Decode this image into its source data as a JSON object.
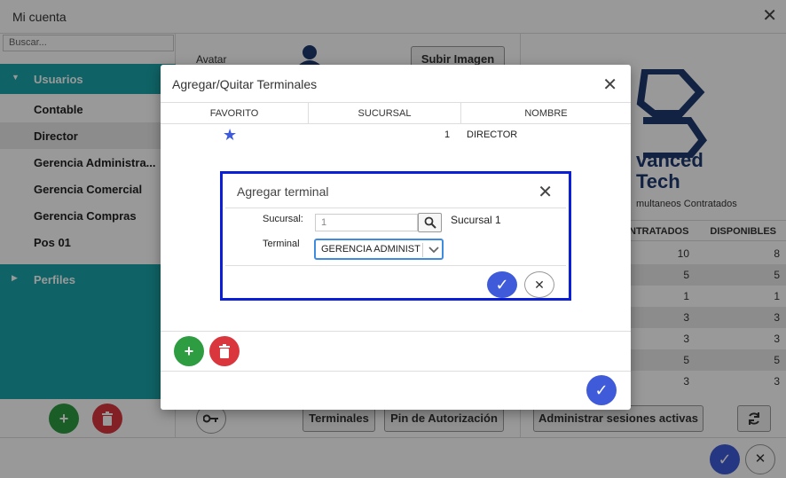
{
  "window": {
    "title": "Mi cuenta"
  },
  "sidebar": {
    "search_placeholder": "Buscar...",
    "group_users": "Usuarios",
    "users": [
      "Contable",
      "Director",
      "Gerencia Administra...",
      "Gerencia Comercial",
      "Gerencia Compras",
      "Pos 01"
    ],
    "selected_user": "Director",
    "group_profiles": "Perfiles"
  },
  "content": {
    "avatar_label": "Avatar",
    "upload_button": "Subir Imagen",
    "terminals_button": "Terminales",
    "pin_button": "Pin de Autorización"
  },
  "right": {
    "logo_line1": "vanced",
    "logo_line2": "Tech",
    "concurrent_label": "multaneos Contratados",
    "col_contracted": "NTRATADOS",
    "col_available": "DISPONIBLES",
    "rows": [
      {
        "contracted": "10",
        "available": "8"
      },
      {
        "contracted": "5",
        "available": "5"
      },
      {
        "contracted": "1",
        "available": "1"
      },
      {
        "contracted": "3",
        "available": "3"
      },
      {
        "contracted": "3",
        "available": "3"
      },
      {
        "contracted": "5",
        "available": "5"
      },
      {
        "contracted": "3",
        "available": "3"
      }
    ],
    "sessions_button": "Administrar sesiones activas"
  },
  "dialog": {
    "title": "Agregar/Quitar Terminales",
    "columns": [
      "FAVORITO",
      "SUCURSAL",
      "NOMBRE"
    ],
    "rows": [
      {
        "favorite": true,
        "branch": "1",
        "name": "DIRECTOR"
      }
    ]
  },
  "inner_dialog": {
    "title": "Agregar terminal",
    "branch_label": "Sucursal:",
    "branch_value": "1",
    "branch_name": "Sucursal 1",
    "terminal_label": "Terminal",
    "terminal_value": "GERENCIA ADMINIST"
  },
  "icons": {
    "add": "+",
    "confirm": "✓",
    "cancel": "✕",
    "close": "✕"
  },
  "colors": {
    "teal": "#1aa3a8",
    "green": "#2e9c40",
    "red": "#d9363e",
    "blue": "#3f5bd9",
    "highlight": "#0b1fd6"
  }
}
